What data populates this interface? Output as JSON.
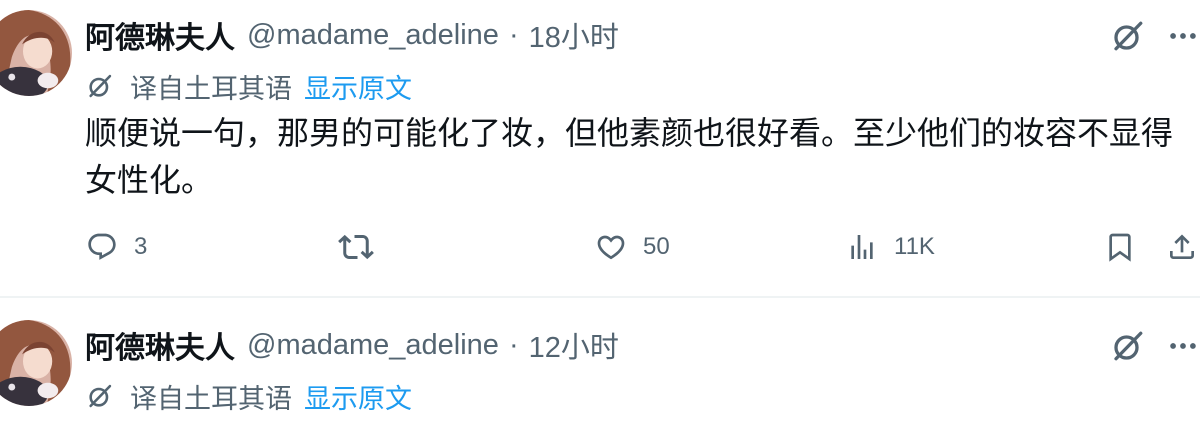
{
  "colors": {
    "text": "#0f1419",
    "secondary": "#536471",
    "link": "#1d9bf0",
    "divider": "#eff3f4",
    "background": "#ffffff"
  },
  "icons": {
    "avatar": "user-avatar",
    "grok": "grok-icon",
    "more": "more-icon",
    "translate": "translate-icon",
    "reply": "reply-icon",
    "repost": "repost-icon",
    "like": "heart-icon",
    "views": "views-icon",
    "bookmark": "bookmark-icon",
    "share": "share-icon"
  },
  "tweets": [
    {
      "author": {
        "name": "阿德琳夫人",
        "handle": "@madame_adeline"
      },
      "separator": "·",
      "time": "18小时",
      "translation": {
        "label": "译自土耳其语",
        "show_original": "显示原文"
      },
      "text_lines": [
        "顺便说一句，那男的可能化了妆，但他素颜也很好看。至少他们的妆容不显得",
        "女性化。"
      ],
      "actions": {
        "replies": "3",
        "likes": "50",
        "views": "11K"
      }
    },
    {
      "author": {
        "name": "阿德琳夫人",
        "handle": "@madame_adeline"
      },
      "separator": "·",
      "time": "12小时",
      "translation": {
        "label": "译自土耳其语",
        "show_original": "显示原文"
      }
    }
  ]
}
